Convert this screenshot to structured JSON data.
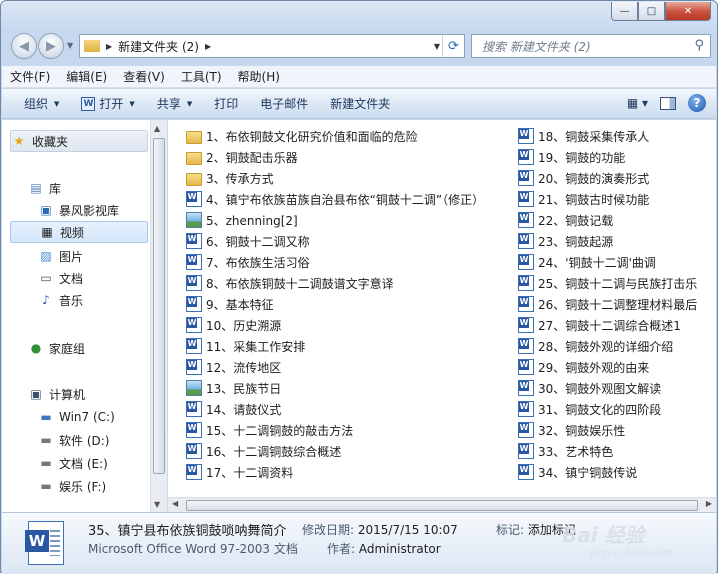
{
  "window": {
    "minimize": "—",
    "maximize": "□",
    "close": "✕"
  },
  "nav": {
    "address": "新建文件夹 (2)",
    "search_placeholder": "搜索 新建文件夹 (2)"
  },
  "menu": [
    "文件(F)",
    "编辑(E)",
    "查看(V)",
    "工具(T)",
    "帮助(H)"
  ],
  "commands": {
    "organize": "组织",
    "open": "打开",
    "share": "共享",
    "print": "打印",
    "email": "电子邮件",
    "new_folder": "新建文件夹",
    "help": "?"
  },
  "sidebar": {
    "favorites": "收藏夹",
    "libraries": "库",
    "lib_items": [
      "暴风影视库",
      "视频",
      "图片",
      "文档",
      "音乐"
    ],
    "homegroup": "家庭组",
    "computer": "计算机",
    "drives": [
      "Win7 (C:)",
      "软件 (D:)",
      "文档 (E:)",
      "娱乐 (F:)"
    ]
  },
  "files": [
    {
      "name": "1、布依铜鼓文化研究价值和面临的危险",
      "icon": "folder-icon"
    },
    {
      "name": "2、铜鼓配击乐器",
      "icon": "folder-icon"
    },
    {
      "name": "3、传承方式",
      "icon": "folder-icon"
    },
    {
      "name": "4、镇宁布依族苗族自治县布依“铜鼓十二调”（修正）",
      "icon": "word-doc-icon"
    },
    {
      "name": "5、zhenning[2]",
      "icon": "image-file-icon"
    },
    {
      "name": "6、铜鼓十二调又称",
      "icon": "word-doc-icon"
    },
    {
      "name": "7、布依族生活习俗",
      "icon": "word-doc-icon"
    },
    {
      "name": "8、布依族铜鼓十二调鼓谱文字意译",
      "icon": "word-doc-icon"
    },
    {
      "name": "9、基本特征",
      "icon": "word-doc-icon"
    },
    {
      "name": "10、历史溯源",
      "icon": "word-doc-icon"
    },
    {
      "name": "11、采集工作安排",
      "icon": "word-doc-icon"
    },
    {
      "name": "12、流传地区",
      "icon": "word-doc-icon"
    },
    {
      "name": "13、民族节日",
      "icon": "image-file-icon"
    },
    {
      "name": "14、请鼓仪式",
      "icon": "word-doc-icon"
    },
    {
      "name": "15、十二调铜鼓的敲击方法",
      "icon": "word-doc-icon"
    },
    {
      "name": "16、十二调铜鼓综合概述",
      "icon": "word-doc-icon"
    },
    {
      "name": "17、十二调资料",
      "icon": "word-doc-icon"
    },
    {
      "name": "18、铜鼓采集传承人",
      "icon": "word-doc-icon"
    },
    {
      "name": "19、铜鼓的功能",
      "icon": "word-doc-icon"
    },
    {
      "name": "20、铜鼓的演奏形式",
      "icon": "word-doc-icon"
    },
    {
      "name": "21、铜鼓古时候功能",
      "icon": "word-doc-icon"
    },
    {
      "name": "22、铜鼓记载",
      "icon": "word-doc-icon"
    },
    {
      "name": "23、铜鼓起源",
      "icon": "word-doc-icon"
    },
    {
      "name": "24、'铜鼓十二调'曲调",
      "icon": "word-doc-icon"
    },
    {
      "name": "25、铜鼓十二调与民族打击乐",
      "icon": "word-doc-icon"
    },
    {
      "name": "26、铜鼓十二调整理材料最后",
      "icon": "word-doc-icon"
    },
    {
      "name": "27、铜鼓十二调综合概述1",
      "icon": "word-doc-icon"
    },
    {
      "name": "28、铜鼓外观的详细介绍",
      "icon": "word-doc-icon"
    },
    {
      "name": "29、铜鼓外观的由来",
      "icon": "word-doc-icon"
    },
    {
      "name": "30、铜鼓外观图文解读",
      "icon": "word-doc-icon"
    },
    {
      "name": "31、铜鼓文化的四阶段",
      "icon": "word-doc-icon"
    },
    {
      "name": "32、铜鼓娱乐性",
      "icon": "word-doc-icon"
    },
    {
      "name": "33、艺术特色",
      "icon": "word-doc-icon"
    },
    {
      "name": "34、镇宁铜鼓传说",
      "icon": "word-doc-icon"
    }
  ],
  "details": {
    "name": "35、镇宁县布依族铜鼓唢呐舞简介",
    "type": "Microsoft Office Word 97-2003 文档",
    "modified_label": "修改日期:",
    "modified_value": "2015/7/15 10:07",
    "author_label": "作者:",
    "author_value": "Administrator",
    "tags_label": "标记:",
    "tags_value": "添加标记"
  },
  "watermark": {
    "text": "Bai 经验",
    "url": "jingyan.baidu.com"
  }
}
